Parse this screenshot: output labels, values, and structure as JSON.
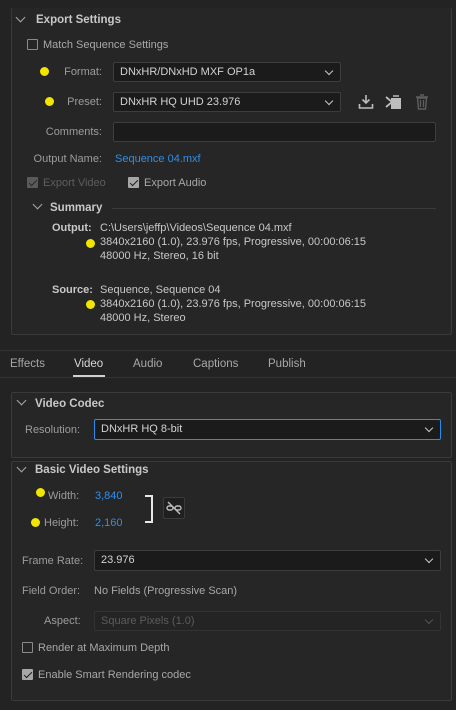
{
  "export_settings": {
    "title": "Export Settings",
    "match_sequence_label": "Match Sequence Settings",
    "format_label": "Format:",
    "format_value": "DNxHR/DNxHD MXF OP1a",
    "preset_label": "Preset:",
    "preset_value": "DNxHR HQ UHD 23.976",
    "comments_label": "Comments:",
    "comments_value": "",
    "output_name_label": "Output Name:",
    "output_name_value": "Sequence 04.mxf",
    "export_video_label": "Export Video",
    "export_audio_label": "Export Audio"
  },
  "summary": {
    "title": "Summary",
    "output_label": "Output:",
    "output_line1": "C:\\Users\\jeffp\\Videos\\Sequence 04.mxf",
    "output_line2": "3840x2160 (1.0), 23.976 fps, Progressive, 00:00:06:15",
    "output_line3": "48000 Hz, Stereo, 16 bit",
    "source_label": "Source:",
    "source_line1": "Sequence, Sequence 04",
    "source_line2": "3840x2160 (1.0), 23.976 fps, Progressive, 00:00:06:15",
    "source_line3": "48000 Hz, Stereo"
  },
  "tabs": [
    "Effects",
    "Video",
    "Audio",
    "Captions",
    "Publish"
  ],
  "video_codec": {
    "title": "Video Codec",
    "resolution_label": "Resolution:",
    "resolution_value": "DNxHR HQ 8-bit"
  },
  "basic_video": {
    "title": "Basic Video Settings",
    "width_label": "Width:",
    "width_value": "3,840",
    "height_label": "Height:",
    "height_value": "2,160",
    "frame_rate_label": "Frame Rate:",
    "frame_rate_value": "23.976",
    "field_order_label": "Field Order:",
    "field_order_value": "No Fields (Progressive Scan)",
    "aspect_label": "Aspect:",
    "aspect_value": "Square Pixels (1.0)",
    "render_max_depth_label": "Render at Maximum Depth",
    "smart_rendering_label": "Enable Smart Rendering codec"
  },
  "colors": {
    "accent_blue": "#2f8ee8",
    "highlight_dot": "#f2e600"
  }
}
